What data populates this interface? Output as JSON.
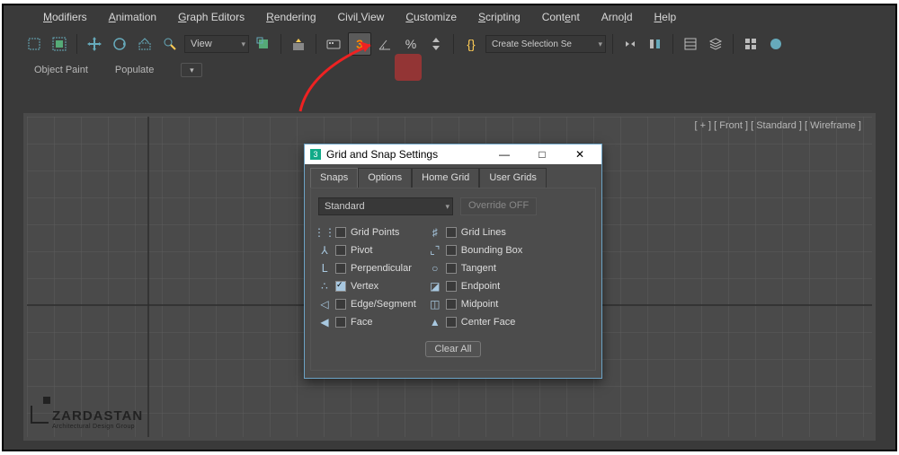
{
  "menu": [
    "Modifiers",
    "Animation",
    "Graph Editors",
    "Rendering",
    "Civil View",
    "Customize",
    "Scripting",
    "Content",
    "Arnold",
    "Help"
  ],
  "menu_underline": [
    0,
    0,
    0,
    0,
    5,
    0,
    0,
    4,
    4,
    0
  ],
  "toolbar": {
    "view_label": "View",
    "selection_set": "Create Selection Se"
  },
  "ribbon": {
    "object_paint": "Object Paint",
    "populate": "Populate"
  },
  "viewport_label": "[ + ] [ Front ] [ Standard ] [ Wireframe ]",
  "dialog": {
    "title": "Grid and Snap Settings",
    "tabs": [
      "Snaps",
      "Options",
      "Home Grid",
      "User Grids"
    ],
    "active_tab": 0,
    "dropdown": "Standard",
    "override": "Override OFF",
    "clear": "Clear All",
    "left": [
      {
        "icon": "⋮⋮",
        "label": "Grid Points",
        "checked": false
      },
      {
        "icon": "⅄",
        "label": "Pivot",
        "checked": false
      },
      {
        "icon": "ᒪ",
        "label": "Perpendicular",
        "checked": false
      },
      {
        "icon": "∴",
        "label": "Vertex",
        "checked": true
      },
      {
        "icon": "◁",
        "label": "Edge/Segment",
        "checked": false
      },
      {
        "icon": "◀",
        "label": "Face",
        "checked": false
      }
    ],
    "right": [
      {
        "icon": "♯",
        "label": "Grid Lines",
        "checked": false
      },
      {
        "icon": "⌞⌝",
        "label": "Bounding Box",
        "checked": false
      },
      {
        "icon": "○",
        "label": "Tangent",
        "checked": false
      },
      {
        "icon": "◪",
        "label": "Endpoint",
        "checked": false
      },
      {
        "icon": "◫",
        "label": "Midpoint",
        "checked": false
      },
      {
        "icon": "▲",
        "label": "Center Face",
        "checked": false
      }
    ]
  },
  "watermark": {
    "brand": "ZARDASTAN",
    "tagline": "Architectural Design Group"
  }
}
